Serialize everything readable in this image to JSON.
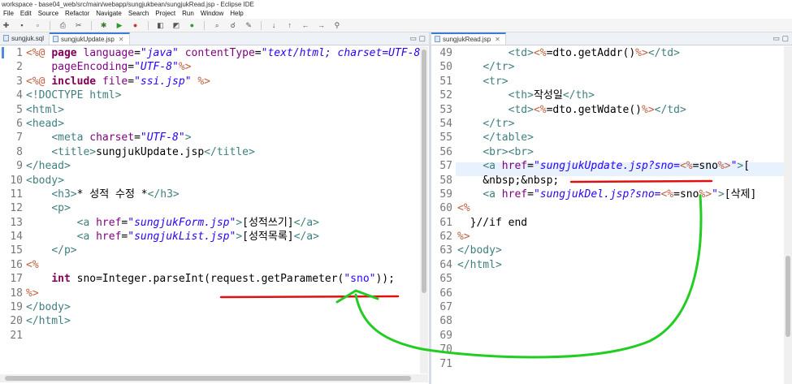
{
  "window": {
    "title": "workspace - base04_web/src/main/webapp/sungjukbean/sungjukRead.jsp - Eclipse IDE"
  },
  "menu": [
    "File",
    "Edit",
    "Source",
    "Refactor",
    "Navigate",
    "Search",
    "Project",
    "Run",
    "Window",
    "Help"
  ],
  "left_editor": {
    "tabs": [
      {
        "label": "sungjuk.sql",
        "active": false
      },
      {
        "label": "sungjukUpdate.jsp",
        "active": true
      }
    ],
    "line_numbers": [
      "1",
      "2",
      "3",
      "4",
      "5",
      "6",
      "7",
      "8",
      "9",
      "10",
      "11",
      "12",
      "13",
      "14",
      "15",
      "16",
      "17",
      "18",
      "19",
      "20",
      "21"
    ],
    "lines": [
      [
        [
          "jsp",
          "<%@ "
        ],
        [
          "kw",
          "page "
        ],
        [
          "attr",
          "language"
        ],
        [
          "plain",
          "="
        ],
        [
          "str",
          "\"java\""
        ],
        [
          "plain",
          " "
        ],
        [
          "attr",
          "contentType"
        ],
        [
          "plain",
          "="
        ],
        [
          "str",
          "\"text/html; charset=UTF-8\""
        ]
      ],
      [
        [
          "plain",
          "    "
        ],
        [
          "attr",
          "pageEncoding"
        ],
        [
          "plain",
          "="
        ],
        [
          "str",
          "\"UTF-8\""
        ],
        [
          "jsp",
          "%>"
        ]
      ],
      [
        [
          "jsp",
          "<%@ "
        ],
        [
          "kw",
          "include "
        ],
        [
          "attr",
          "file"
        ],
        [
          "plain",
          "="
        ],
        [
          "str",
          "\"ssi.jsp\""
        ],
        [
          "plain",
          " "
        ],
        [
          "jsp",
          "%>"
        ]
      ],
      [
        [
          "dkw",
          "<!DOCTYPE html>"
        ]
      ],
      [
        [
          "tag",
          "<html>"
        ]
      ],
      [
        [
          "tag",
          "<head>"
        ]
      ],
      [
        [
          "plain",
          "    "
        ],
        [
          "tag",
          "<meta "
        ],
        [
          "attr",
          "charset"
        ],
        [
          "plain",
          "="
        ],
        [
          "str",
          "\"UTF-8\""
        ],
        [
          "tag",
          ">"
        ]
      ],
      [
        [
          "plain",
          "    "
        ],
        [
          "tag",
          "<title>"
        ],
        [
          "plain",
          "sungjukUpdate.jsp"
        ],
        [
          "tag",
          "</title>"
        ]
      ],
      [
        [
          "tag",
          "</head>"
        ]
      ],
      [
        [
          "tag",
          "<body>"
        ]
      ],
      [
        [
          "plain",
          "    "
        ],
        [
          "tag",
          "<h3>"
        ],
        [
          "plain",
          "* 성적 수정 *"
        ],
        [
          "tag",
          "</h3>"
        ]
      ],
      [
        [
          "plain",
          "    "
        ],
        [
          "tag",
          "<p>"
        ]
      ],
      [
        [
          "plain",
          "        "
        ],
        [
          "tag",
          "<a "
        ],
        [
          "attr",
          "href"
        ],
        [
          "plain",
          "="
        ],
        [
          "str",
          "\"sungjukForm.jsp\""
        ],
        [
          "tag",
          ">"
        ],
        [
          "plain",
          "[성적쓰기]"
        ],
        [
          "tag",
          "</a>"
        ]
      ],
      [
        [
          "plain",
          "        "
        ],
        [
          "tag",
          "<a "
        ],
        [
          "attr",
          "href"
        ],
        [
          "plain",
          "="
        ],
        [
          "str",
          "\"sungjukList.jsp\""
        ],
        [
          "tag",
          ">"
        ],
        [
          "plain",
          "[성적목록]"
        ],
        [
          "tag",
          "</a>"
        ]
      ],
      [
        [
          "plain",
          "    "
        ],
        [
          "tag",
          "</p>"
        ]
      ],
      [
        [
          "jsp",
          "<%"
        ]
      ],
      [
        [
          "plain",
          "    "
        ],
        [
          "kw",
          "int"
        ],
        [
          "plain",
          " sno=Integer.parseInt(request.getParameter("
        ],
        [
          "jstr",
          "\"sno\""
        ],
        [
          "plain",
          "));"
        ]
      ],
      [
        [
          "jsp",
          "%>"
        ]
      ],
      [
        [
          "tag",
          "</body>"
        ]
      ],
      [
        [
          "tag",
          "</html>"
        ]
      ],
      []
    ]
  },
  "right_editor": {
    "tabs": [
      {
        "label": "sungjukRead.jsp",
        "active": true
      }
    ],
    "line_numbers": [
      "49",
      "50",
      "51",
      "52",
      "53",
      "54",
      "55",
      "56",
      "57",
      "58",
      "59",
      "60",
      "61",
      "62",
      "63",
      "64",
      "65",
      "66",
      "67",
      "68",
      "69",
      "70",
      "71"
    ],
    "current_line": "57",
    "lines": [
      [
        [
          "plain",
          "        "
        ],
        [
          "tag",
          "<td>"
        ],
        [
          "jsp",
          "<%"
        ],
        [
          "plain",
          "=dto.getAddr()"
        ],
        [
          "jsp",
          "%>"
        ],
        [
          "tag",
          "</td>"
        ]
      ],
      [
        [
          "plain",
          "    "
        ],
        [
          "tag",
          "</tr>"
        ]
      ],
      [
        [
          "plain",
          "    "
        ],
        [
          "tag",
          "<tr>"
        ]
      ],
      [
        [
          "plain",
          "        "
        ],
        [
          "tag",
          "<th>"
        ],
        [
          "plain",
          "작성일"
        ],
        [
          "tag",
          "</th>"
        ]
      ],
      [
        [
          "plain",
          "        "
        ],
        [
          "tag",
          "<td>"
        ],
        [
          "jsp",
          "<%"
        ],
        [
          "plain",
          "=dto.getWdate()"
        ],
        [
          "jsp",
          "%>"
        ],
        [
          "tag",
          "</td>"
        ]
      ],
      [
        [
          "plain",
          "    "
        ],
        [
          "tag",
          "</tr>"
        ]
      ],
      [
        [
          "plain",
          "    "
        ],
        [
          "tag",
          "</table>"
        ]
      ],
      [
        [
          "plain",
          "    "
        ],
        [
          "tag",
          "<br><br>"
        ]
      ],
      [
        [
          "plain",
          "    "
        ],
        [
          "tag",
          "<a "
        ],
        [
          "attr",
          "href"
        ],
        [
          "plain",
          "="
        ],
        [
          "str",
          "\"sungjukUpdate.jsp?sno="
        ],
        [
          "jsp",
          "<%"
        ],
        [
          "plain",
          "=sno"
        ],
        [
          "jsp",
          "%>"
        ],
        [
          "str",
          "\""
        ],
        [
          "tag",
          ">"
        ],
        [
          "plain",
          "["
        ]
      ],
      [
        [
          "plain",
          "    &nbsp;&nbsp;"
        ]
      ],
      [
        [
          "plain",
          "    "
        ],
        [
          "tag",
          "<a "
        ],
        [
          "attr",
          "href"
        ],
        [
          "plain",
          "="
        ],
        [
          "str",
          "\"sungjukDel.jsp?sno="
        ],
        [
          "jsp",
          "<%"
        ],
        [
          "plain",
          "=sno"
        ],
        [
          "jsp",
          "%>"
        ],
        [
          "str",
          "\""
        ],
        [
          "tag",
          ">"
        ],
        [
          "plain",
          "[삭제]"
        ]
      ],
      [
        [
          "jsp",
          "<%"
        ]
      ],
      [
        [
          "plain",
          "  }//if end"
        ]
      ],
      [
        [
          "jsp",
          "%>"
        ]
      ],
      [
        [
          "tag",
          "</body>"
        ]
      ],
      [
        [
          "tag",
          "</html>"
        ]
      ],
      [],
      [],
      [],
      [],
      [],
      [],
      []
    ]
  },
  "annotation": {
    "color": "#22cc22",
    "underline_color": "#e01010"
  }
}
